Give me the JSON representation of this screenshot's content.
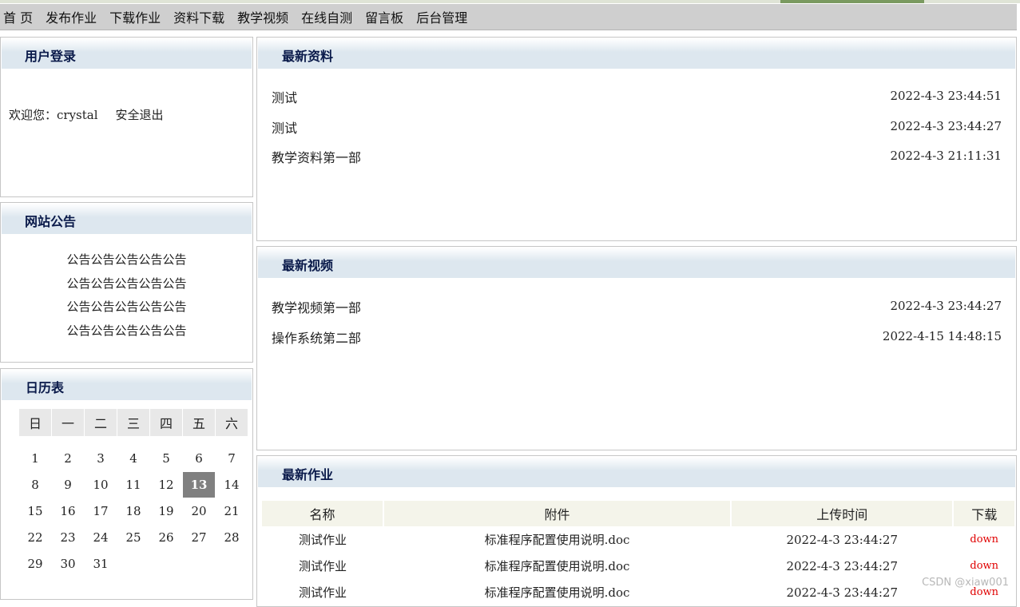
{
  "nav": [
    "首 页",
    "发布作业",
    "下载作业",
    "资料下载",
    "教学视频",
    "在线自测",
    "留言板",
    "后台管理"
  ],
  "login": {
    "title": "用户登录",
    "welcome_prefix": "欢迎您：",
    "username": "crystal",
    "logout": "安全退出"
  },
  "notice": {
    "title": "网站公告",
    "lines": [
      "公告公告公告公告公告",
      "公告公告公告公告公告",
      "公告公告公告公告公告",
      "公告公告公告公告公告"
    ]
  },
  "calendar": {
    "title": "日历表",
    "weekdays": [
      "日",
      "一",
      "二",
      "三",
      "四",
      "五",
      "六"
    ],
    "weeks": [
      [
        "1",
        "2",
        "3",
        "4",
        "5",
        "6",
        "7"
      ],
      [
        "8",
        "9",
        "10",
        "11",
        "12",
        "13",
        "14"
      ],
      [
        "15",
        "16",
        "17",
        "18",
        "19",
        "20",
        "21"
      ],
      [
        "22",
        "23",
        "24",
        "25",
        "26",
        "27",
        "28"
      ],
      [
        "29",
        "30",
        "31",
        "",
        "",
        "",
        ""
      ]
    ],
    "today": "13"
  },
  "latest_resources": {
    "title": "最新资料",
    "items": [
      {
        "name": "测试",
        "time": "2022-4-3 23:44:51"
      },
      {
        "name": "测试",
        "time": "2022-4-3 23:44:27"
      },
      {
        "name": "教学资料第一部",
        "time": "2022-4-3 21:11:31"
      }
    ]
  },
  "latest_videos": {
    "title": "最新视频",
    "items": [
      {
        "name": "教学视频第一部",
        "time": "2022-4-3 23:44:27"
      },
      {
        "name": "操作系统第二部",
        "time": "2022-4-15 14:48:15"
      }
    ]
  },
  "latest_homework": {
    "title": "最新作业",
    "headers": [
      "名称",
      "附件",
      "上传时间",
      "下载"
    ],
    "rows": [
      {
        "name": "测试作业",
        "file": "标准程序配置使用说明.doc",
        "time": "2022-4-3 23:44:27",
        "download": "down"
      },
      {
        "name": "测试作业",
        "file": "标准程序配置使用说明.doc",
        "time": "2022-4-3 23:44:27",
        "download": "down"
      },
      {
        "name": "测试作业",
        "file": "标准程序配置使用说明.doc",
        "time": "2022-4-3 23:44:27",
        "download": "down"
      }
    ]
  },
  "watermark": "CSDN @xiaw001"
}
